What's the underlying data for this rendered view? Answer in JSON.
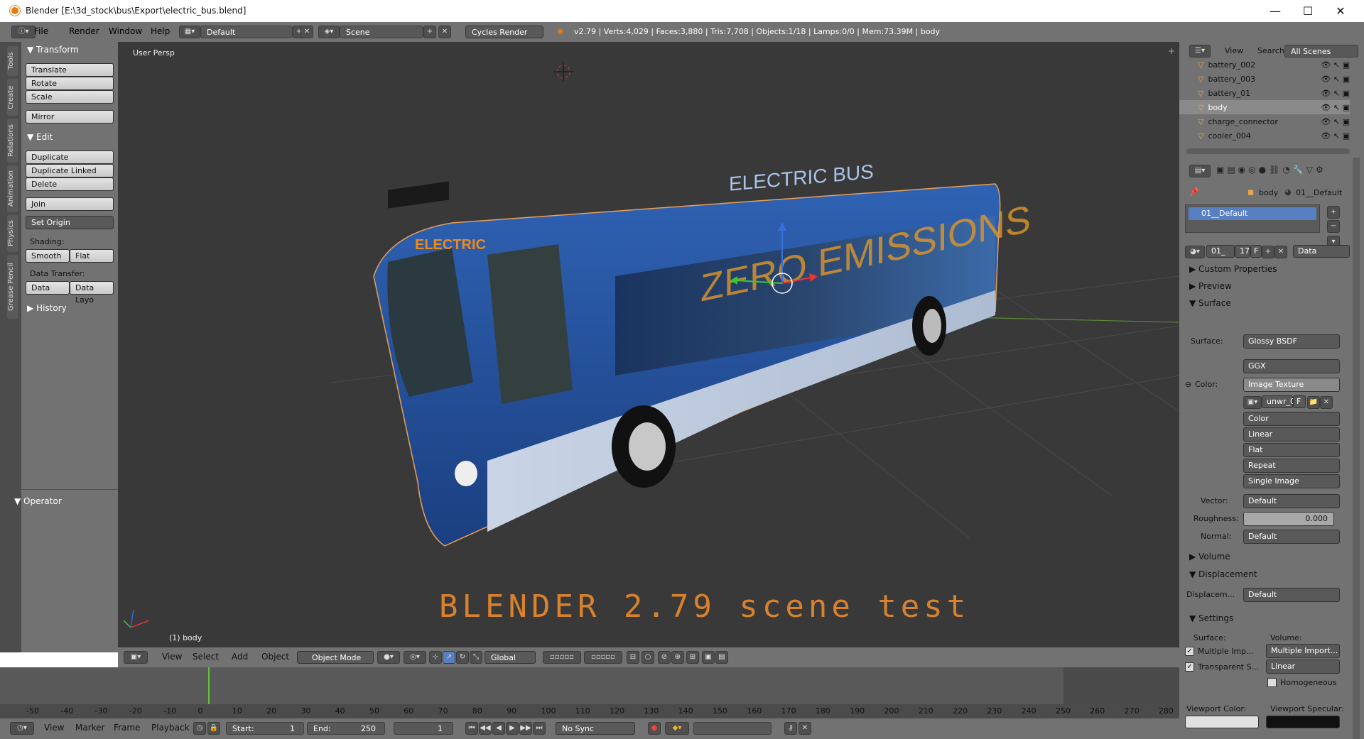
{
  "window": {
    "title": "Blender [E:\\3d_stock\\bus\\Export\\electric_bus.blend]",
    "minimize": "—",
    "maximize": "☐",
    "close": "✕"
  },
  "info": {
    "menus": [
      "File",
      "Render",
      "Window",
      "Help"
    ],
    "layout": "Default",
    "scene": "Scene",
    "engine": "Cycles Render",
    "stats": "v2.79 | Verts:4,029 | Faces:3,880 | Tris:7,708 | Objects:1/18 | Lamps:0/0 | Mem:73.39M | body"
  },
  "tabs": [
    "Tools",
    "Create",
    "Relations",
    "Animation",
    "Physics",
    "Grease Pencil"
  ],
  "toolshelf": {
    "transform": "Transform",
    "translate": "Translate",
    "rotate": "Rotate",
    "scale": "Scale",
    "mirror": "Mirror",
    "edit": "Edit",
    "duplicate": "Duplicate",
    "duplicate_linked": "Duplicate Linked",
    "delete": "Delete",
    "join": "Join",
    "set_origin": "Set Origin",
    "shading": "Shading:",
    "smooth": "Smooth",
    "flat": "Flat",
    "data_transfer": "Data Transfer:",
    "data": "Data",
    "data_layo": "Data Layo",
    "history": "History",
    "operator": "Operator"
  },
  "viewport": {
    "view_label": "User Persp",
    "object_label": "(1) body",
    "overlay_text": "BLENDER 2.79 scene test",
    "bus_sign": "ELECTRIC",
    "bus_text1": "ELECTRIC BUS",
    "bus_text2": "ZERO EMISSIONS"
  },
  "vp_header": {
    "menus": [
      "View",
      "Select",
      "Add",
      "Object"
    ],
    "mode": "Object Mode",
    "orientation": "Global"
  },
  "timeline": {
    "ticks": [
      "-50",
      "-40",
      "-30",
      "-20",
      "-10",
      "0",
      "10",
      "20",
      "30",
      "40",
      "50",
      "60",
      "70",
      "80",
      "90",
      "100",
      "110",
      "120",
      "130",
      "140",
      "150",
      "160",
      "170",
      "180",
      "190",
      "200",
      "210",
      "220",
      "230",
      "240",
      "250",
      "260",
      "270",
      "280"
    ],
    "current_frame_fraction": 0.0
  },
  "tl_header": {
    "menus": [
      "View",
      "Marker",
      "Frame",
      "Playback"
    ],
    "start_label": "Start:",
    "start": "1",
    "end_label": "End:",
    "end": "250",
    "current": "1",
    "sync": "No Sync"
  },
  "outliner": {
    "view": "View",
    "search": "Search",
    "scenes": "All Scenes",
    "items": [
      "battery_002",
      "battery_003",
      "battery_01",
      "body",
      "charge_connector",
      "cooler_004"
    ]
  },
  "props": {
    "crumb_body": "body",
    "crumb_mat": "01__Default",
    "material_slot": "01__Default",
    "mat_name": "01_",
    "users": "17",
    "fake": "F",
    "link": "Data",
    "custom_props": "Custom Properties",
    "preview": "Preview",
    "surface": "Surface",
    "surface_label": "Surface:",
    "surface_value": "Glossy BSDF",
    "distribution": "GGX",
    "color_label": "Color:",
    "color_value": "Image Texture",
    "image": "unwr_0",
    "image_f": "F",
    "color_space": "Color",
    "interp": "Linear",
    "projection": "Flat",
    "extension": "Repeat",
    "source": "Single Image",
    "vector_label": "Vector:",
    "vector_value": "Default",
    "roughness_label": "Roughness:",
    "roughness_value": "0.000",
    "normal_label": "Normal:",
    "normal_value": "Default",
    "volume": "Volume",
    "displacement": "Displacement",
    "disp_label": "Displacem...",
    "disp_value": "Default",
    "settings": "Settings",
    "surface2": "Surface:",
    "volume2": "Volume:",
    "multiple_imp": "Multiple Imp...",
    "multiple_import": "Multiple Import...",
    "transparent": "Transparent S...",
    "linear": "Linear",
    "homogeneous": "Homogeneous",
    "vp_color": "Viewport Color:",
    "vp_specular": "Viewport Specular:"
  }
}
